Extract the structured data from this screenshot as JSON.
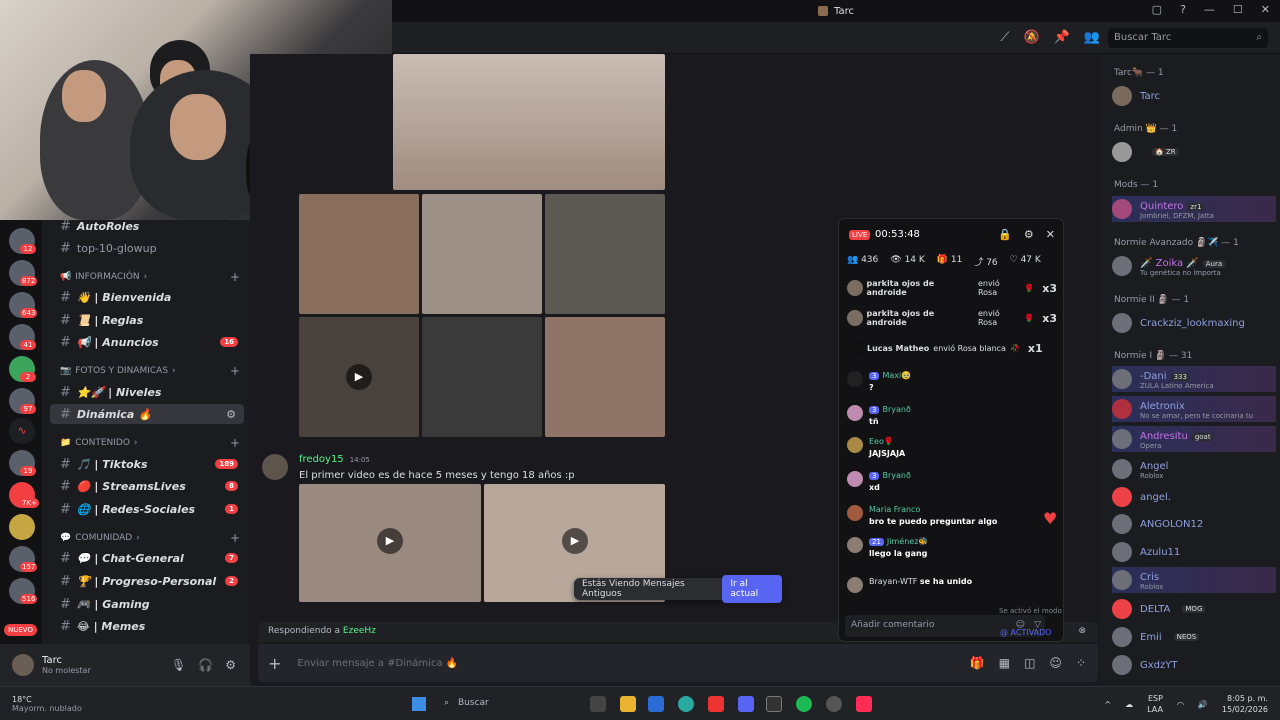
{
  "window": {
    "title": "Tarc"
  },
  "header": {
    "search_placeholder": "Buscar Tarc"
  },
  "rail": {
    "badges": [
      "12",
      "872",
      "643",
      "41",
      "2",
      "97",
      "19",
      "7K+",
      "157",
      "516"
    ],
    "nuevo": "NUEVO"
  },
  "channels": {
    "top": [
      {
        "label": "AutoRoles"
      },
      {
        "label": "top-10-glowup"
      }
    ],
    "categories": [
      {
        "name": "INFORMACIÓN",
        "items": [
          {
            "label": "👋 | Bienvenida"
          },
          {
            "label": "📜 | Reglas"
          },
          {
            "label": "📢 | Anuncios",
            "badge": "16"
          }
        ]
      },
      {
        "name": "FOTOS Y DINAMICAS",
        "items": [
          {
            "label": "⭐🚀 | Niveles"
          },
          {
            "label": "Dinámica 🔥",
            "active": true
          }
        ]
      },
      {
        "name": "CONTENIDO",
        "items": [
          {
            "label": "🎵 | Tiktoks",
            "badge": "189"
          },
          {
            "label": "🔴 | StreamsLives",
            "badge": "8"
          },
          {
            "label": "🌐 | Redes-Sociales",
            "badge": "1"
          }
        ]
      },
      {
        "name": "COMUNIDAD",
        "items": [
          {
            "label": "💬 | Chat-General",
            "badge": "7"
          },
          {
            "label": "🏆 | Progreso-Personal",
            "badge": "2"
          },
          {
            "label": "🎮 | Gaming"
          },
          {
            "label": "😂 | Memes"
          }
        ]
      }
    ]
  },
  "user": {
    "name": "Tarc",
    "status": "No molestar"
  },
  "chat": {
    "message": {
      "author": "fredoy15",
      "time": "14:05",
      "text": "El primer video es de hace 5 meses y tengo 18 años :p"
    },
    "old_messages": {
      "text": "Estás Viendo Mensajes Antiguos",
      "button": "Ir al actual"
    },
    "reply": {
      "prefix": "Respondiendo a ",
      "target": "EzeeHz"
    },
    "composer_placeholder": "Enviar mensaje a #Dinámica 🔥"
  },
  "live": {
    "badge": "LIVE",
    "time": "00:53:48",
    "stats": [
      "436",
      "14 K",
      "11",
      "76",
      "47 K"
    ],
    "gifts": [
      {
        "user": "parkita ojos de androide",
        "action": "envió Rosa",
        "count": "x3"
      },
      {
        "user": "parkita ojos de androide",
        "action": "envió Rosa",
        "count": "x3"
      },
      {
        "user": "Lucas Matheo",
        "action": "envió Rosa blanca",
        "count": "x1"
      }
    ],
    "comments": [
      {
        "user": "Maxi🥹",
        "level": "3",
        "text": "?"
      },
      {
        "user": "Bryanð",
        "level": "3",
        "text": "tñ"
      },
      {
        "user": "Eeo🌹",
        "level": "",
        "text": "JAJSJAJA"
      },
      {
        "user": "Bryanð",
        "level": "3",
        "text": "xd"
      },
      {
        "user": "Maria Franco",
        "level": "",
        "text": "bro te puedo preguntar algo"
      },
      {
        "user": "Jiménez🐝",
        "level": "21",
        "text": "llego la gang"
      },
      {
        "user": "Brayan-WTF",
        "level": "",
        "text": "se ha unido"
      }
    ],
    "paused": "Se activó el modo pausado",
    "input_placeholder": "Añadir comentario",
    "activado": "@ ACTIVADO"
  },
  "members": {
    "roles": [
      {
        "name": "Tarc🐂 — 1",
        "members": [
          {
            "name": "Tarc",
            "sub": ""
          }
        ]
      },
      {
        "name": "Admin 👑 — 1",
        "members": [
          {
            "name": "",
            "sub": "",
            "tag": "🏠 ZR"
          }
        ]
      },
      {
        "name": "Mods — 1",
        "members": [
          {
            "name": "Quintero",
            "sub": "Jombriel, DFZM, Jatta",
            "tag": "zr1",
            "hl": true
          }
        ]
      },
      {
        "name": "Normie Avanzado 🗿✈️ — 1",
        "members": [
          {
            "name": "🗡️ Zoika 🗡️",
            "sub": "Tu genética no importa",
            "tag": "Aura"
          }
        ]
      },
      {
        "name": "Normie II 🗿 — 1",
        "members": [
          {
            "name": "Crackziz_lookmaxing",
            "sub": ""
          }
        ]
      },
      {
        "name": "Normie I 🗿 — 31",
        "members": [
          {
            "name": "-Dani",
            "sub": "ZULA Latino America",
            "tag": "333",
            "hl": true
          },
          {
            "name": "Aletronix",
            "sub": "No se amar, pero te cocinaria tu",
            "tag": "",
            "hl": true
          },
          {
            "name": "Andresitu",
            "sub": "Opera",
            "tag": "goat",
            "hl": true
          },
          {
            "name": "Angel",
            "sub": "Roblox"
          },
          {
            "name": "angel.",
            "sub": ""
          },
          {
            "name": "ANGOLON12",
            "sub": ""
          },
          {
            "name": "Azulu11",
            "sub": ""
          },
          {
            "name": "Cris",
            "sub": "Roblox",
            "hl": true
          },
          {
            "name": "DELTA",
            "sub": "",
            "tag": "MOG"
          },
          {
            "name": "Emii",
            "sub": "",
            "tag": "NEOS"
          },
          {
            "name": "GxdzYT",
            "sub": ""
          }
        ]
      }
    ]
  },
  "taskbar": {
    "temp": "18°C",
    "weather": "Mayorm. nublado",
    "search": "Buscar",
    "lang": "ESP",
    "lang2": "LAA",
    "time": "8:05 p. m.",
    "date": "15/02/2026"
  }
}
